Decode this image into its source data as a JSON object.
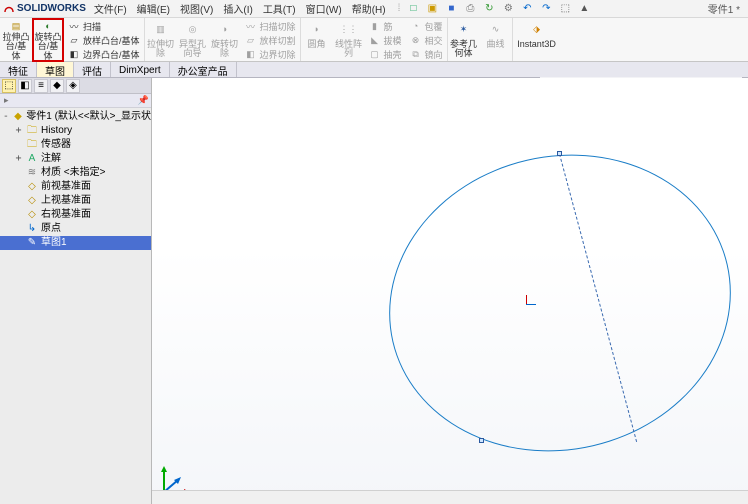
{
  "app": {
    "brand": "SOLIDWORKS",
    "doc_title": "零件1 *"
  },
  "menubar": {
    "items": [
      "文件(F)",
      "编辑(E)",
      "视图(V)",
      "插入(I)",
      "工具(T)",
      "窗口(W)",
      "帮助(H)"
    ]
  },
  "qat_icons": [
    "new-doc-icon",
    "open-icon",
    "save-icon",
    "print-icon",
    "rebuild-icon",
    "options-icon",
    "undo-icon",
    "redo-icon",
    "select-icon",
    "pointer-icon"
  ],
  "ribbon": {
    "groups": [
      {
        "big": [
          {
            "label": "拉伸凸\n台/基\n体",
            "icon": "extrude-boss-icon",
            "name": "extrude-boss-button"
          },
          {
            "label": "旋转凸\n台/基\n体",
            "icon": "revolve-boss-icon",
            "name": "revolve-boss-button",
            "highlight": true
          }
        ],
        "rows": [
          {
            "icon": "swept-boss-icon",
            "label": "扫描",
            "name": "swept-boss-button"
          },
          {
            "icon": "lofted-boss-icon",
            "label": "放样凸台/基体",
            "name": "lofted-boss-button"
          },
          {
            "icon": "boundary-boss-icon",
            "label": "边界凸台/基体",
            "name": "boundary-boss-button"
          }
        ]
      },
      {
        "big": [
          {
            "label": "拉伸切\n除",
            "icon": "extrude-cut-icon",
            "name": "extrude-cut-button",
            "muted": true
          },
          {
            "label": "异型孔\n向导",
            "icon": "hole-wizard-icon",
            "name": "hole-wizard-button",
            "muted": true
          },
          {
            "label": "旋转切\n除",
            "icon": "revolve-cut-icon",
            "name": "revolve-cut-button",
            "muted": true
          }
        ],
        "rows": [
          {
            "icon": "swept-cut-icon",
            "label": "扫描切除",
            "name": "swept-cut-button",
            "muted": true
          },
          {
            "icon": "lofted-cut-icon",
            "label": "放样切割",
            "name": "lofted-cut-button",
            "muted": true
          },
          {
            "icon": "boundary-cut-icon",
            "label": "边界切除",
            "name": "boundary-cut-button",
            "muted": true
          }
        ]
      },
      {
        "big": [
          {
            "label": "圆角",
            "icon": "fillet-icon",
            "name": "fillet-button",
            "muted": true
          },
          {
            "label": "线性阵\n列",
            "icon": "linear-pattern-icon",
            "name": "linear-pattern-button",
            "muted": true
          }
        ],
        "rows": [
          {
            "icon": "rib-icon",
            "label": "筋",
            "name": "rib-button",
            "muted": true
          },
          {
            "icon": "draft-icon",
            "label": "拔模",
            "name": "draft-button",
            "muted": true
          },
          {
            "icon": "shell-icon",
            "label": "抽壳",
            "name": "shell-button",
            "muted": true
          }
        ],
        "rows2": [
          {
            "icon": "wrap-icon",
            "label": "包覆",
            "name": "wrap-button",
            "muted": true
          },
          {
            "icon": "intersect-icon",
            "label": "相交",
            "name": "intersect-button",
            "muted": true
          },
          {
            "icon": "mirror-icon",
            "label": "镜向",
            "name": "mirror-button",
            "muted": true
          }
        ]
      },
      {
        "big": [
          {
            "label": "参考几\n何体",
            "icon": "reference-geometry-icon",
            "name": "reference-geometry-button"
          },
          {
            "label": "曲线",
            "icon": "curves-icon",
            "name": "curves-button",
            "muted": true
          }
        ]
      },
      {
        "big": [
          {
            "label": "Instant3D",
            "icon": "instant3d-icon",
            "name": "instant3d-button"
          }
        ]
      }
    ]
  },
  "designtabs": {
    "items": [
      "特征",
      "草图",
      "评估",
      "DimXpert",
      "办公室产品"
    ],
    "active_index": 1
  },
  "viewtoolbar_icons": [
    "zoom-fit-icon",
    "zoom-area-icon",
    "prev-view-icon",
    "section-view-icon",
    "view-orientation-icon",
    "display-style-icon",
    "hide-show-icon",
    "edit-appearance-icon",
    "apply-scene-icon",
    "view-settings-icon"
  ],
  "tree": {
    "root": "零件1 (默认<<默认>_显示状",
    "nodes": [
      {
        "icon": "history-folder-icon",
        "label": "History",
        "toggle": "+",
        "name": "tree-history"
      },
      {
        "icon": "sensors-folder-icon",
        "label": "传感器",
        "name": "tree-sensors"
      },
      {
        "icon": "annotations-folder-icon",
        "label": "注解",
        "toggle": "+",
        "name": "tree-annotations"
      },
      {
        "icon": "material-icon",
        "label": "材质 <未指定>",
        "name": "tree-material"
      },
      {
        "icon": "plane-icon",
        "label": "前视基准面",
        "name": "tree-front-plane"
      },
      {
        "icon": "plane-icon",
        "label": "上视基准面",
        "name": "tree-top-plane"
      },
      {
        "icon": "plane-icon",
        "label": "右视基准面",
        "name": "tree-right-plane"
      },
      {
        "icon": "origin-icon",
        "label": "原点",
        "name": "tree-origin"
      },
      {
        "icon": "sketch-icon",
        "label": "草图1",
        "name": "tree-sketch1",
        "selected": true
      }
    ]
  },
  "colors": {
    "highlight": "#d40000",
    "sketch": "#1a7dc7",
    "selection": "#4a6fd1"
  }
}
